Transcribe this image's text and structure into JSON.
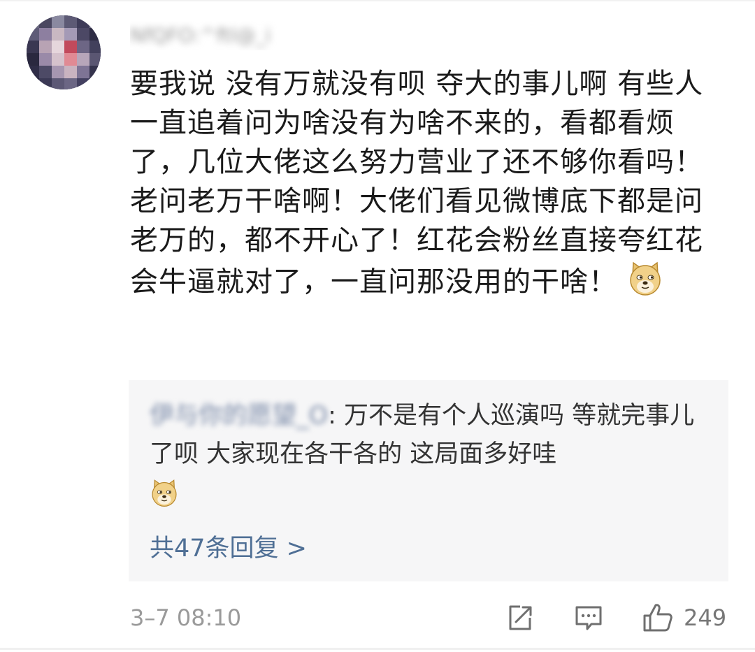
{
  "comment": {
    "username": "NfQFO:^ftl@_i",
    "body": "要我说 没有万就没有呗  夺大的事儿啊  有些人一直追着问为啥没有为啥不来的，看都看烦了，几位大佬这么努力营业了还不够你看吗！老问老万干啥啊！大佬们看见微博底下都是问老万的，都不开心了！红花会粉丝直接夸红花会牛逼就对了，一直问那没用的干啥！",
    "emoji_icon": "doge-emoji-icon",
    "timestamp": "3–7 08:10"
  },
  "reply": {
    "username": "伊与你的愿望_O",
    "separator": ":",
    "text": " 万不是有个人巡演吗 等就完事儿了呗  大家现在各干各的  这局面多好哇",
    "emoji_icon": "doge-emoji-icon",
    "more_link": "共47条回复 >"
  },
  "actions": {
    "repost_icon": "repost-icon",
    "comment_icon": "comment-icon",
    "like_icon": "thumbs-up-icon",
    "like_count": "249"
  },
  "colors": {
    "link": "#4f6f95",
    "meta": "#9a9a9a",
    "reply_bg": "#f6f6f7",
    "text": "#1a1a1a"
  }
}
